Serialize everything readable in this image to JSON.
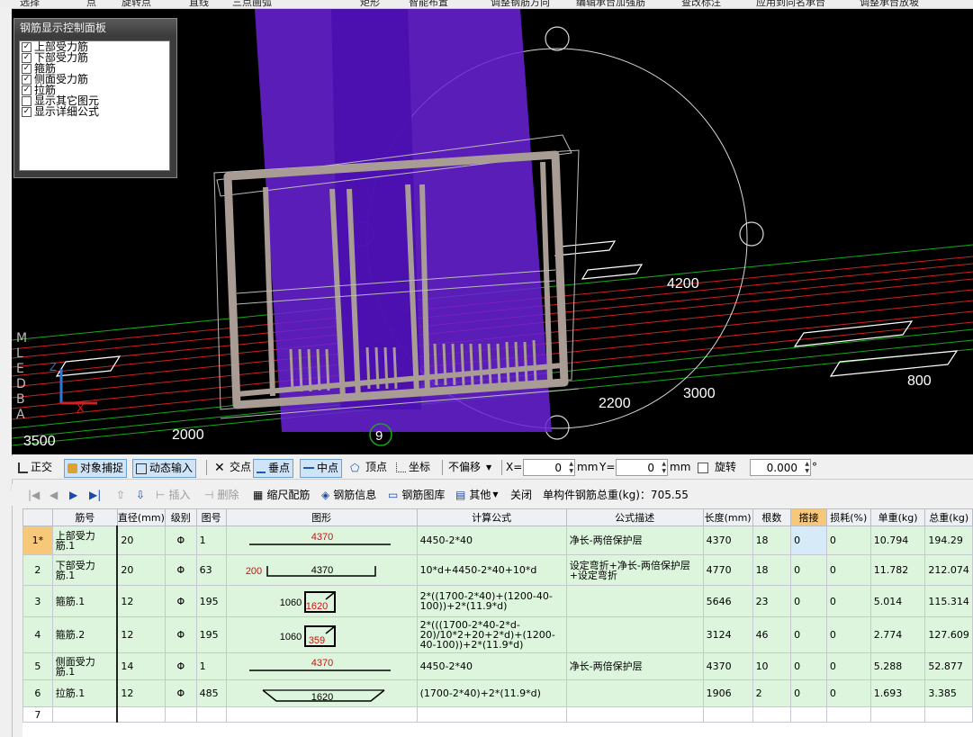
{
  "top_toolbar": {
    "items": [
      "选择",
      "点",
      "旋转点",
      "直线",
      "三点画弧",
      "矩形",
      "智能布置",
      "调整钢筋方向",
      "编辑承台加强筋",
      "查改标注",
      "应用到同名承台",
      "调整承台放坡"
    ]
  },
  "display_panel": {
    "title": "钢筋显示控制面板",
    "options": [
      {
        "label": "上部受力筋",
        "checked": true
      },
      {
        "label": "下部受力筋",
        "checked": true
      },
      {
        "label": "箍筋",
        "checked": true
      },
      {
        "label": "侧面受力筋",
        "checked": true
      },
      {
        "label": "拉筋",
        "checked": true
      },
      {
        "label": "显示其它图元",
        "checked": false
      },
      {
        "label": "显示详细公式",
        "checked": true
      }
    ]
  },
  "viewport": {
    "dimension_labels": [
      "4200",
      "3000",
      "2200",
      "800",
      "2000",
      "3500"
    ],
    "axis_marker": "9",
    "grid_letters": [
      "M",
      "L",
      "E",
      "D",
      "B",
      "A"
    ],
    "axis_x": "X",
    "axis_y": "Z"
  },
  "snap_bar": {
    "ortho": "正交",
    "object_snap": "对象捕捉",
    "dynamic_input": "动态输入",
    "intersection": "交点",
    "perpendicular": "垂点",
    "midpoint": "中点",
    "vertex": "顶点",
    "coordinate": "坐标",
    "offset_mode": "不偏移",
    "x_label": "X=",
    "x_value": "0",
    "x_unit": "mm",
    "y_label": "Y=",
    "y_value": "0",
    "y_unit": "mm",
    "rotate_label": "旋转",
    "rotate_value": "0.000",
    "degree": "°"
  },
  "rebar_toolbar": {
    "insert": "插入",
    "delete": "删除",
    "scale": "缩尺配筋",
    "info": "钢筋信息",
    "library": "钢筋图库",
    "other": "其他",
    "close": "关闭",
    "total_weight": "单构件钢筋总重(kg)：705.55"
  },
  "table": {
    "headers": [
      "",
      "筋号",
      "直径(mm)",
      "级别",
      "图号",
      "图形",
      "计算公式",
      "公式描述",
      "长度(mm)",
      "根数",
      "搭接",
      "损耗(%)",
      "单重(kg)",
      "总重(kg)"
    ],
    "rows": [
      {
        "num": "1*",
        "name": "上部受力筋.1",
        "dia": "20",
        "grade": "Φ",
        "fig": "1",
        "shape": {
          "type": "straight",
          "labels": [
            "4370"
          ]
        },
        "formula": "4450-2*40",
        "desc": "净长-两倍保护层",
        "length": "4370",
        "count": "18",
        "lap": "0",
        "loss": "0",
        "unit_wt": "10.794",
        "total_wt": "194.29"
      },
      {
        "num": "2",
        "name": "下部受力筋.1",
        "dia": "20",
        "grade": "Φ",
        "fig": "63",
        "shape": {
          "type": "hook-up",
          "labels": [
            "200",
            "4370"
          ]
        },
        "formula": "10*d+4450-2*40+10*d",
        "desc": "设定弯折+净长-两倍保护层+设定弯折",
        "length": "4770",
        "count": "18",
        "lap": "0",
        "loss": "0",
        "unit_wt": "11.782",
        "total_wt": "212.074"
      },
      {
        "num": "3",
        "name": "箍筋.1",
        "dia": "12",
        "grade": "Φ",
        "fig": "195",
        "shape": {
          "type": "stirrup",
          "labels": [
            "1060",
            "1620"
          ]
        },
        "formula": "2*((1700-2*40)+(1200-40-100))+2*(11.9*d)",
        "desc": "",
        "length": "5646",
        "count": "23",
        "lap": "0",
        "loss": "0",
        "unit_wt": "5.014",
        "total_wt": "115.314"
      },
      {
        "num": "4",
        "name": "箍筋.2",
        "dia": "12",
        "grade": "Φ",
        "fig": "195",
        "shape": {
          "type": "stirrup",
          "labels": [
            "1060",
            "359"
          ]
        },
        "formula": "2*(((1700-2*40-2*d-20)/10*2+20+2*d)+(1200-40-100))+2*(11.9*d)",
        "desc": "",
        "length": "3124",
        "count": "46",
        "lap": "0",
        "loss": "0",
        "unit_wt": "2.774",
        "total_wt": "127.609"
      },
      {
        "num": "5",
        "name": "侧面受力筋.1",
        "dia": "14",
        "grade": "Φ",
        "fig": "1",
        "shape": {
          "type": "straight",
          "labels": [
            "4370"
          ]
        },
        "formula": "4450-2*40",
        "desc": "净长-两倍保护层",
        "length": "4370",
        "count": "10",
        "lap": "0",
        "loss": "0",
        "unit_wt": "5.288",
        "total_wt": "52.877"
      },
      {
        "num": "6",
        "name": "拉筋.1",
        "dia": "12",
        "grade": "Φ",
        "fig": "485",
        "shape": {
          "type": "tie",
          "labels": [
            "1620"
          ]
        },
        "formula": "(1700-2*40)+2*(11.9*d)",
        "desc": "",
        "length": "1906",
        "count": "2",
        "lap": "0",
        "loss": "0",
        "unit_wt": "1.693",
        "total_wt": "3.385"
      }
    ],
    "empty_row_num": "7"
  },
  "colors": {
    "row_green": "#dcf5dc",
    "header_highlight": "#f7c77a",
    "viewport_bg": "#000000",
    "slab_purple": "#6a22d8",
    "rebar_gray": "#a89c94"
  }
}
